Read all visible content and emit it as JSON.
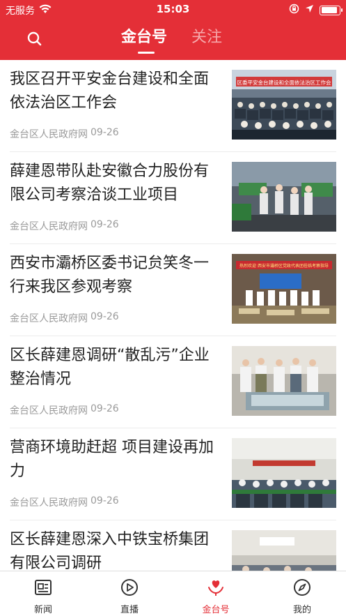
{
  "status_bar": {
    "carrier": "无服务",
    "time": "15:03",
    "battery_level": 0.9
  },
  "header": {
    "search_icon": "search-icon",
    "tabs": [
      {
        "label": "金台号",
        "active": true
      },
      {
        "label": "关注",
        "active": false
      }
    ]
  },
  "news": [
    {
      "title": "我区召开平安金台建设和全面依法治区工作会",
      "source": "金台区人民政府网",
      "date": "09-26",
      "thumb_banner": "区委平安金台建设和全面依法治区工作会"
    },
    {
      "title": "薛建恩带队赴安徽合力股份有限公司考察洽谈工业项目",
      "source": "金台区人民政府网",
      "date": "09-26",
      "thumb_banner": ""
    },
    {
      "title": "西安市灞桥区委书记贠笑冬一行来我区参观考察",
      "source": "金台区人民政府网",
      "date": "09-26",
      "thumb_banner": "热烈欢迎 西安市灞桥区党政代表团莅临考察指导"
    },
    {
      "title": "区长薛建恩调研“散乱污”企业整治情况",
      "source": "金台区人民政府网",
      "date": "09-26",
      "thumb_banner": ""
    },
    {
      "title": "营商环境助赶超 项目建设再加力",
      "source": "金台区人民政府网",
      "date": "09-26",
      "thumb_banner": ""
    },
    {
      "title": "区长薛建恩深入中铁宝桥集团有限公司调研",
      "source": "",
      "date": "",
      "thumb_banner": ""
    }
  ],
  "bottom_nav": [
    {
      "label": "新闻",
      "icon": "news-icon",
      "active": false
    },
    {
      "label": "直播",
      "icon": "play-icon",
      "active": false
    },
    {
      "label": "金台号",
      "icon": "heart-hand-icon",
      "active": true
    },
    {
      "label": "我的",
      "icon": "compass-icon",
      "active": false
    }
  ],
  "colors": {
    "brand_red": "#e42f37",
    "tab_inactive": "#f6a7aa",
    "meta_gray": "#9a9a9a"
  }
}
